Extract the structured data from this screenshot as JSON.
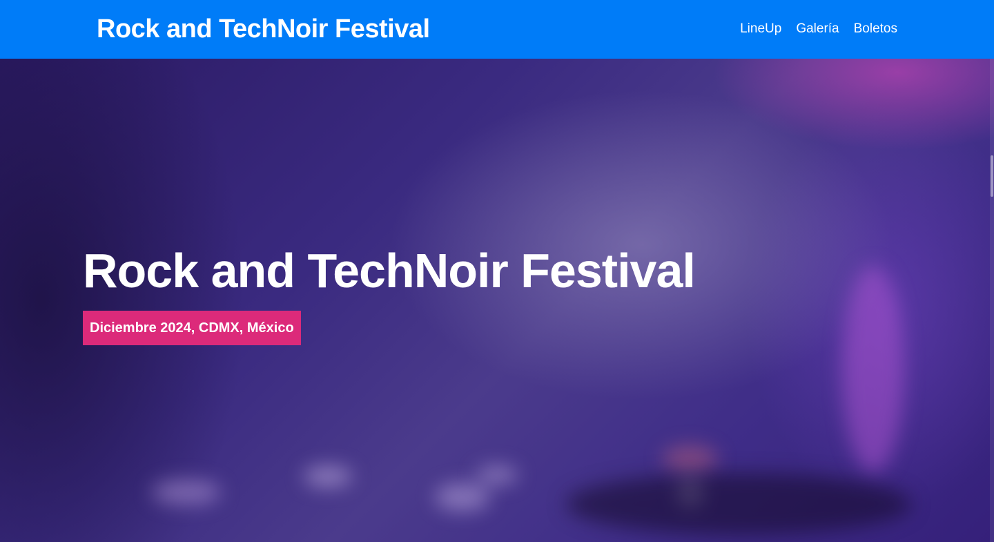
{
  "header": {
    "brand": "Rock and TechNoir Festival",
    "nav": [
      {
        "label": "LineUp"
      },
      {
        "label": "Galería"
      },
      {
        "label": "Boletos"
      }
    ]
  },
  "hero": {
    "title": "Rock and TechNoir Festival",
    "badge": "Diciembre 2024, CDMX, México"
  },
  "colors": {
    "header_bg": "#007cf8",
    "badge_bg": "#dc2a7a",
    "hero_overlay": "#3a2a80"
  }
}
